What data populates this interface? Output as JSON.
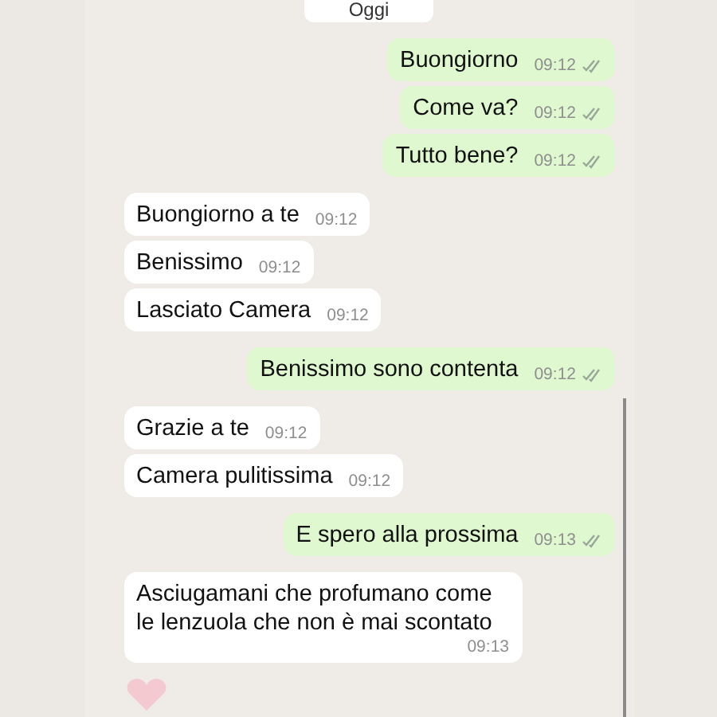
{
  "date_badge": "Oggi",
  "groups": [
    {
      "kind": "sent",
      "messages": [
        {
          "text": "Buongiorno",
          "time": "09:12"
        },
        {
          "text": "Come va?",
          "time": "09:12"
        },
        {
          "text": "Tutto bene?",
          "time": "09:12"
        }
      ]
    },
    {
      "kind": "received",
      "messages": [
        {
          "text": "Buongiorno a te",
          "time": "09:12"
        },
        {
          "text": "Benissimo",
          "time": "09:12"
        },
        {
          "text": "Lasciato Camera",
          "time": "09:12"
        }
      ]
    },
    {
      "kind": "sent",
      "messages": [
        {
          "text": "Benissimo sono contenta",
          "time": "09:12"
        }
      ]
    },
    {
      "kind": "received",
      "messages": [
        {
          "text": "Grazie a te",
          "time": "09:12"
        },
        {
          "text": "Camera pulitissima",
          "time": "09:12"
        }
      ]
    },
    {
      "kind": "sent",
      "messages": [
        {
          "text": "E spero alla prossima",
          "time": "09:13"
        }
      ]
    },
    {
      "kind": "received",
      "messages": [
        {
          "text": "Asciugamani che profumano come le lenzuola che non è mai scontato",
          "time": "09:13"
        }
      ]
    }
  ]
}
